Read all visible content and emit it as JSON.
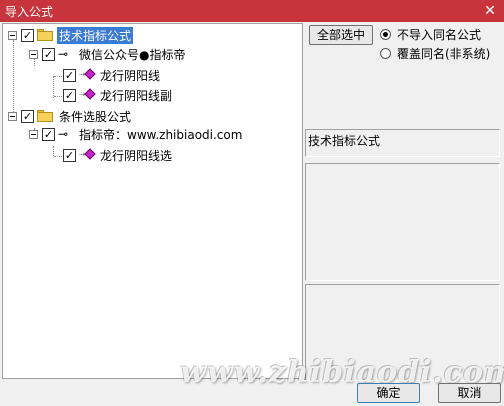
{
  "window": {
    "title": "导入公式",
    "close_glyph": "✕"
  },
  "tree": {
    "root1": {
      "label": "技术指标公式",
      "checked": "✓"
    },
    "group1": {
      "label": "微信公众号●指标帝",
      "checked": "✓",
      "key_glyph": "⊸"
    },
    "item1": {
      "label": "龙行阴阳线",
      "checked": "✓"
    },
    "item2": {
      "label": "龙行阴阳线副",
      "checked": "✓"
    },
    "root2": {
      "label": "条件选股公式",
      "checked": "✓"
    },
    "group2": {
      "label": "指标帝：www.zhibiaodi.com",
      "checked": "✓",
      "key_glyph": "⊸"
    },
    "item3": {
      "label": "龙行阴阳线选",
      "checked": "✓"
    }
  },
  "options": {
    "select_all_label": "全部选中",
    "radio1_label": "不导入同名公式",
    "radio2_label": "覆盖同名(非系统)",
    "selected_radio": "不导入同名公式"
  },
  "info": {
    "category_label": "技术指标公式"
  },
  "watermark": "www.zhibiaodi.com",
  "footer": {
    "ok_label": "确定",
    "cancel_label": "取消"
  },
  "colors": {
    "titlebar": "#c8343c",
    "selection": "#3a7bd5",
    "diamond": "#cc22cc",
    "folder": "#f4d258"
  }
}
